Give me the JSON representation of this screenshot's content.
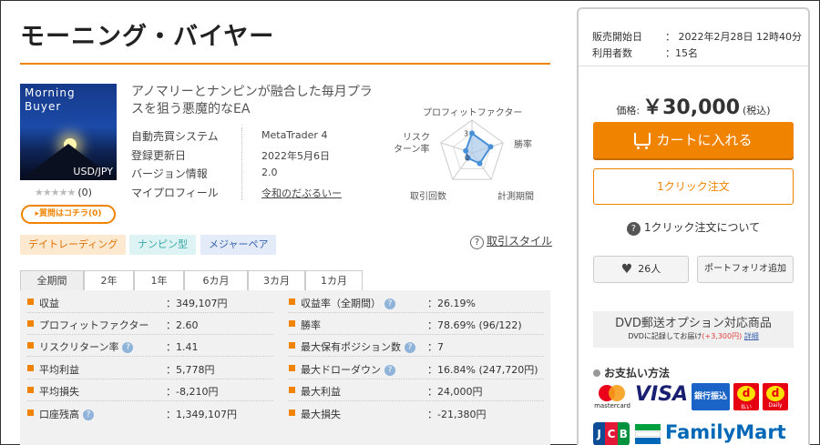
{
  "product": {
    "title": "モーニング・バイヤー",
    "cover": {
      "line1": "Morning",
      "line2": "Buyer",
      "pair": "USD/JPY"
    },
    "rating_stars": "★★★★★",
    "rating_count": "(0)",
    "ask_button": "▸質問はコチラ(0)",
    "headline": "アノマリーとナンピンが融合した毎月プラスを狙う悪魔的なEA"
  },
  "specs": [
    {
      "label": "自動売買システム",
      "value": "MetaTrader 4"
    },
    {
      "label": "登録更新日",
      "value": "2022年5月6日"
    },
    {
      "label": "バージョン情報",
      "value": "2.0"
    },
    {
      "label": "マイプロフィール",
      "value": "令和のだぶるいー"
    }
  ],
  "radar": {
    "labels": {
      "pf": "プロフィットファクター",
      "winrate": "勝率",
      "period": "計測期間",
      "trades": "取引回数",
      "risk_line1": "リスク",
      "risk_line2": "ターン率"
    },
    "scores": {
      "pf": 3,
      "winrate": 3,
      "period": 2,
      "trades": 1,
      "risk": 1
    },
    "max_score": 5,
    "tick_top": "3",
    "tick_bottom": "0",
    "colors": {
      "fill": "#a9c9ea",
      "stroke": "#4a90d9",
      "grid": "#cccccc"
    }
  },
  "tags": [
    "デイトレーディング",
    "ナンピン型",
    "メジャーペア"
  ],
  "trade_style": {
    "icon": "?",
    "label": "取引スタイル"
  },
  "tabs": [
    "全期間",
    "2年",
    "1年",
    "6カ月",
    "3カ月",
    "1カ月"
  ],
  "stats_left": [
    {
      "label": "収益",
      "value": "：349,107円",
      "help": false
    },
    {
      "label": "プロフィットファクター",
      "value": "：2.60",
      "help": false
    },
    {
      "label": "リスクリターン率",
      "value": "：1.41",
      "help": true
    },
    {
      "label": "平均利益",
      "value": "：5,778円",
      "help": false
    },
    {
      "label": "平均損失",
      "value": "：-8,210円",
      "help": false
    },
    {
      "label": "口座残高",
      "value": "：1,349,107円",
      "help": true
    }
  ],
  "stats_right": [
    {
      "label": "収益率（全期間）",
      "value": "：26.19%",
      "help": true
    },
    {
      "label": "勝率",
      "value": "：78.69% (96/122)",
      "help": false
    },
    {
      "label": "最大保有ポジション数",
      "value": "：7",
      "help": true
    },
    {
      "label": "最大ドローダウン",
      "value": "：16.84% (247,720円)",
      "help": true
    },
    {
      "label": "最大利益",
      "value": "：24,000円",
      "help": false
    },
    {
      "label": "最大損失",
      "value": "：-21,380円",
      "help": false
    }
  ],
  "help_icon": "?",
  "sidebar": {
    "sale_start_label": "販売開始日",
    "sale_start_value": "：  2022年2月28日 12時40分",
    "users_label": "利用者数",
    "users_value": "：15名",
    "price_label": "価格:",
    "price_value": "￥30,000",
    "price_tax": "(税込)",
    "cart_button": "カートに入れる",
    "oneclick_button": "1クリック注文",
    "oneclick_about": "1クリック注文について",
    "oneclick_icon": "?",
    "favorite_heart": "♥",
    "favorite_count": "26人",
    "portfolio_button": "ポートフォリオ追加",
    "dvd_title": "DVD郵送オプション対応商品",
    "dvd_sub_prefix": "DVDに記録してお届け",
    "dvd_sub_price": "(+3,300円)",
    "dvd_sub_detail": "詳細",
    "payment_title": "お支払い方法",
    "payment": {
      "mastercard": "mastercard",
      "visa": "VISA",
      "bank": "銀行振込",
      "d_mark": "d",
      "d_pay": "払い",
      "d_daily": "Daily",
      "jcb": [
        "J",
        "C",
        "B"
      ],
      "familymart": "FamilyMart"
    }
  }
}
